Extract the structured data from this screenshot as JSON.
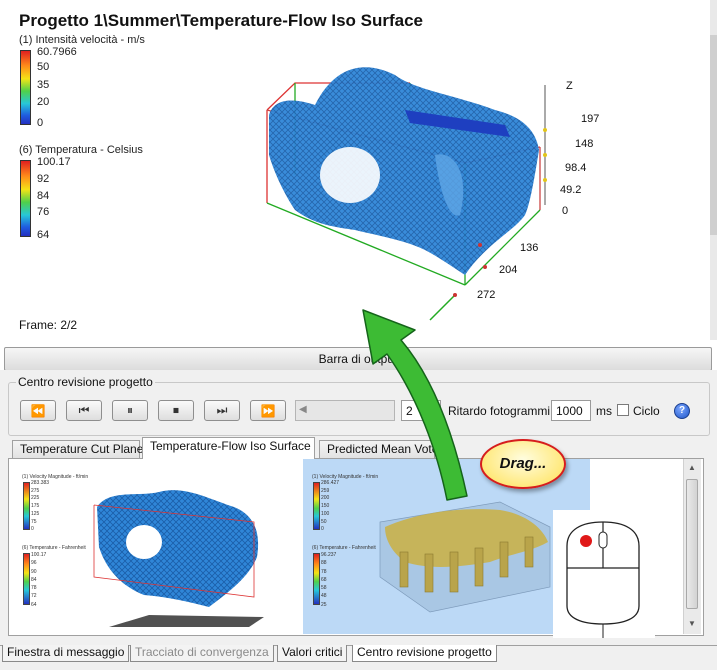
{
  "viewport": {
    "title": "Progetto 1\\Summer\\Temperature-Flow Iso Surface",
    "legend1": {
      "title": "(1) Intensità velocità - m/s",
      "ticks": [
        "60.7966",
        "50",
        "35",
        "20",
        "0"
      ]
    },
    "legend2": {
      "title": "(6) Temperatura - Celsius",
      "ticks": [
        "100.17",
        "92",
        "84",
        "76",
        "64"
      ]
    },
    "axis": {
      "z_label": "Z",
      "z_ticks": [
        "197",
        "148",
        "98.4",
        "49.2",
        "0"
      ],
      "x_ticks": [
        "136",
        "204",
        "272"
      ]
    },
    "frame": "Frame: 2/2"
  },
  "output_bar": {
    "label": "Barra di output"
  },
  "review": {
    "group_title": "Centro revisione progetto",
    "buttons": [
      {
        "name": "rewind-button",
        "icon": "⏪"
      },
      {
        "name": "step-back-button",
        "icon": "⏮"
      },
      {
        "name": "pause-button",
        "icon": "⏸"
      },
      {
        "name": "stop-button",
        "icon": "⏹"
      },
      {
        "name": "step-forward-button",
        "icon": "⏭"
      },
      {
        "name": "fast-forward-button",
        "icon": "⏩"
      }
    ],
    "frame_value": "2",
    "delay_label": "Ritardo fotogrammi:",
    "delay_value": "1000",
    "delay_unit": "ms",
    "loop_label": "Ciclo",
    "help_icon": "?"
  },
  "tabs": [
    {
      "label": "Temperature Cut Plane"
    },
    {
      "label": "Temperature-Flow Iso Surface"
    },
    {
      "label": "Predicted Mean Vote"
    }
  ],
  "thumbnails": {
    "t1": {
      "legend1_title": "(1) Velocity Magnitude - ft/min",
      "legend1_ticks": [
        "283.383",
        "275",
        "225",
        "175",
        "125",
        "75",
        "0"
      ],
      "legend2_title": "(6) Temperature - Fahrenheit",
      "legend2_ticks": [
        "100.17",
        "96",
        "90",
        "84",
        "78",
        "72",
        "64"
      ]
    },
    "t2": {
      "legend1_title": "(1) Velocity Magnitude - ft/min",
      "legend1_ticks": [
        "286.427",
        "259",
        "200",
        "150",
        "100",
        "50",
        "0"
      ],
      "legend2_title": "(6) Temperature - Fahrenheit",
      "legend2_ticks": [
        "96.237",
        "88",
        "78",
        "68",
        "58",
        "48",
        "25"
      ]
    }
  },
  "callout": {
    "text": "Drag..."
  },
  "bottom_tabs": [
    {
      "label": "Finestra di messaggio",
      "state": "normal"
    },
    {
      "label": "Tracciato di convergenza",
      "state": "disabled"
    },
    {
      "label": "Valori critici",
      "state": "normal"
    },
    {
      "label": "Centro revisione progetto",
      "state": "active"
    }
  ],
  "colors": {
    "selection_bg": "#bcd9f6",
    "arrow_green": "#35b52e",
    "callout_border": "#d61d1d",
    "mesh_blue": "#2b7cd3"
  }
}
